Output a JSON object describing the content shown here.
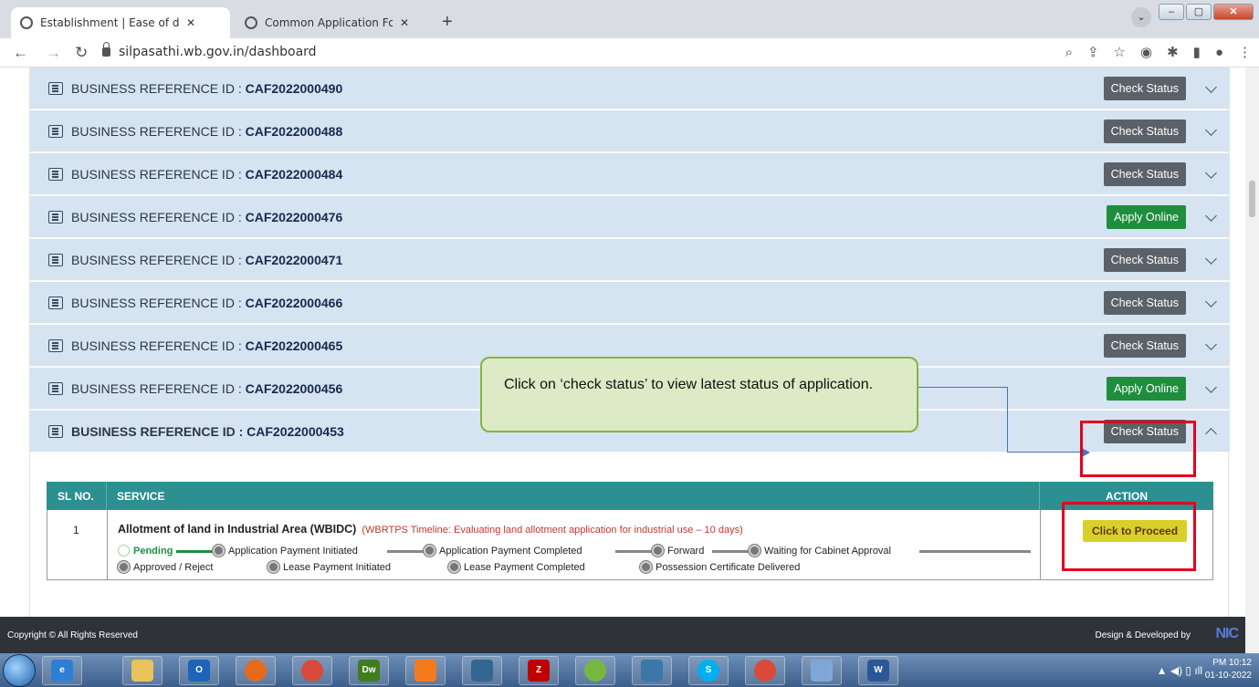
{
  "browser": {
    "tabs": [
      {
        "label": "Establishment | Ease of doing bu",
        "active": true
      },
      {
        "label": "Common Application Form Previ",
        "active": false
      }
    ],
    "new_tab": "+",
    "url": "silpasathi.wb.gov.in/dashboard"
  },
  "rows": [
    {
      "label": "BUSINESS REFERENCE ID :",
      "id": "CAF2022000490",
      "action": "Check Status"
    },
    {
      "label": "BUSINESS REFERENCE ID :",
      "id": "CAF2022000488",
      "action": "Check Status"
    },
    {
      "label": "BUSINESS REFERENCE ID :",
      "id": "CAF2022000484",
      "action": "Check Status"
    },
    {
      "label": "BUSINESS REFERENCE ID :",
      "id": "CAF2022000476",
      "action": "Apply Online"
    },
    {
      "label": "BUSINESS REFERENCE ID :",
      "id": "CAF2022000471",
      "action": "Check Status"
    },
    {
      "label": "BUSINESS REFERENCE ID :",
      "id": "CAF2022000466",
      "action": "Check Status"
    },
    {
      "label": "BUSINESS REFERENCE ID :",
      "id": "CAF2022000465",
      "action": "Check Status"
    },
    {
      "label": "BUSINESS REFERENCE ID :",
      "id": "CAF2022000456",
      "action": "Apply Online"
    },
    {
      "label": "BUSINESS REFERENCE ID :",
      "id": "CAF2022000453",
      "action": "Check Status"
    }
  ],
  "table": {
    "headers": {
      "sl": "SL NO.",
      "service": "SERVICE",
      "action": "ACTION"
    },
    "row": {
      "sl": "1",
      "service": "Allotment of land in Industrial Area (WBIDC)",
      "timeline": "(WBRTPS Timeline: Evaluating land allotment application for industrial use – 10 days)",
      "stages": [
        "Pending",
        "Application Payment Initiated",
        "Application Payment Completed",
        "Forward",
        "Waiting for Cabinet Approval",
        "Approved / Reject",
        "Lease Payment Initiated",
        "Lease Payment Completed",
        "Possession Certificate Delivered"
      ],
      "action": "Click to Proceed"
    }
  },
  "callout": "Click on ‘check status’ to view latest status of application.",
  "footer": {
    "copyright": "Copyright © All Rights Reserved",
    "design": "Design & Developed by",
    "logo": "NIC"
  },
  "taskbar": {
    "apps": [
      "ie-icon",
      "explorer-icon",
      "outlook-icon",
      "firefox-icon",
      "chrome-icon",
      "Dw",
      "xampp-icon",
      "postgres-icon",
      "filezilla-icon",
      "utorrent-icon",
      "python-icon",
      "skype-icon",
      "chrome-icon",
      "notepad-icon",
      "word-icon"
    ],
    "time": "PM 10:12",
    "date": "01-10-2022"
  },
  "colors": {
    "row_bg": "#d6e3f0",
    "check_status": "#5b6168",
    "apply_online": "#1e8e3e",
    "table_header": "#2c8f90",
    "proceed": "#d9cf2b",
    "highlight": "#e3001b",
    "callout_bg": "#dcebc6"
  }
}
